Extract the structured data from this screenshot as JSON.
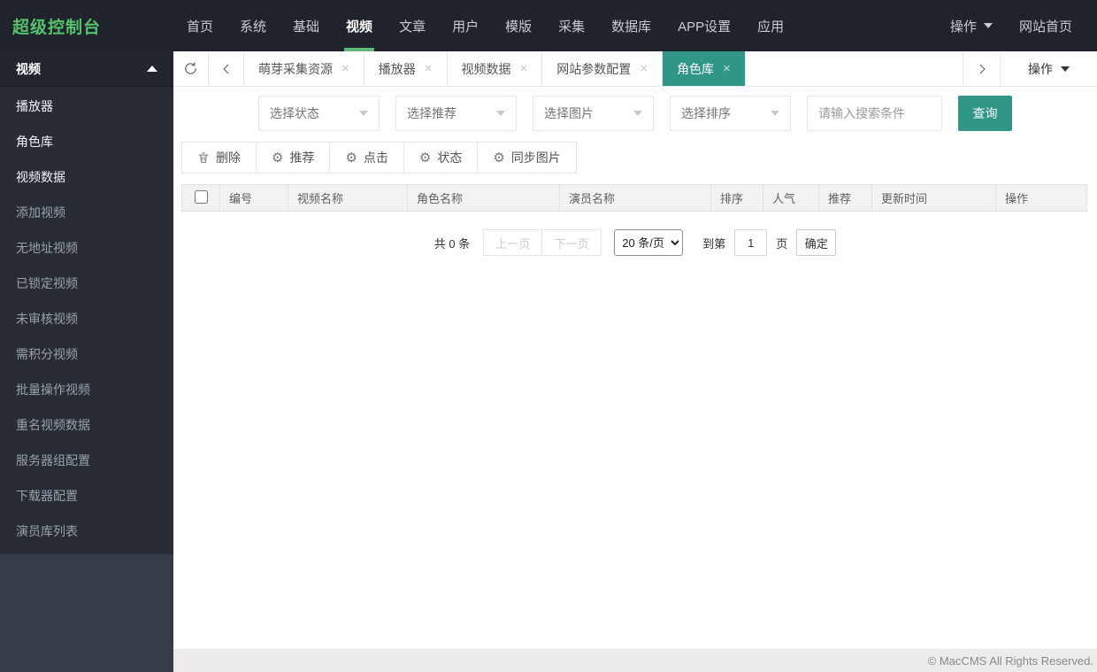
{
  "colors": {
    "accent": "#2f9688",
    "nav_green": "#5FB878",
    "logo_green": "#55c26a"
  },
  "navbar": {
    "logo": "超级控制台",
    "items": [
      {
        "label": "首页"
      },
      {
        "label": "系统"
      },
      {
        "label": "基础"
      },
      {
        "label": "视频"
      },
      {
        "label": "文章"
      },
      {
        "label": "用户"
      },
      {
        "label": "模版"
      },
      {
        "label": "采集"
      },
      {
        "label": "数据库"
      },
      {
        "label": "APP设置"
      },
      {
        "label": "应用"
      }
    ],
    "ops_label": "操作",
    "home_label": "网站首页"
  },
  "sidebar": {
    "header": "视频",
    "items": [
      {
        "label": "播放器"
      },
      {
        "label": "角色库"
      },
      {
        "label": "视频数据"
      },
      {
        "label": "添加视频"
      },
      {
        "label": "无地址视频"
      },
      {
        "label": "已锁定视频"
      },
      {
        "label": "未审核视频"
      },
      {
        "label": "需积分视频"
      },
      {
        "label": "批量操作视频"
      },
      {
        "label": "重名视频数据"
      },
      {
        "label": "服务器组配置"
      },
      {
        "label": "下载器配置"
      },
      {
        "label": "演员库列表"
      }
    ]
  },
  "tabbar": {
    "tabs": [
      {
        "label": "萌芽采集资源"
      },
      {
        "label": "播放器"
      },
      {
        "label": "视频数据"
      },
      {
        "label": "网站参数配置"
      },
      {
        "label": "角色库"
      }
    ],
    "close_glyph": "×",
    "ops_label": "操作"
  },
  "filters": {
    "selects": [
      {
        "label": "选择状态"
      },
      {
        "label": "选择推荐"
      },
      {
        "label": "选择图片"
      },
      {
        "label": "选择排序"
      }
    ],
    "search_placeholder": "请输入搜索条件",
    "submit_label": "查询"
  },
  "actions": {
    "buttons": [
      {
        "label": "删除"
      },
      {
        "label": "推荐"
      },
      {
        "label": "点击"
      },
      {
        "label": "状态"
      },
      {
        "label": "同步图片"
      }
    ],
    "gear_glyph": "⚙"
  },
  "table": {
    "headers": [
      "编号",
      "视频名称",
      "角色名称",
      "演员名称",
      "排序",
      "人气",
      "推荐",
      "更新时间",
      "操作"
    ],
    "rows": []
  },
  "pagination": {
    "total": "共 0 条",
    "prev": "上一页",
    "next": "下一页",
    "per_page": "20 条/页",
    "goto_prefix": "到第",
    "goto_value": "1",
    "goto_suffix": "页",
    "confirm": "确定"
  },
  "footer": {
    "copyright": "© MacCMS All Rights Reserved."
  }
}
